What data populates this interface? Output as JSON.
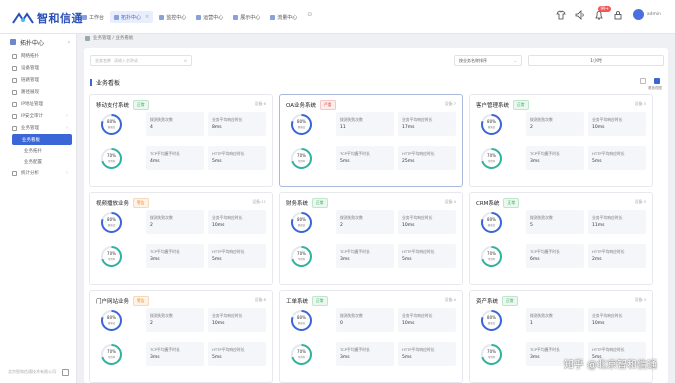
{
  "brand": {
    "name": "智和信通"
  },
  "tabs": [
    {
      "label": "工作台",
      "active": false
    },
    {
      "label": "拓扑中心",
      "active": true
    },
    {
      "label": "监控中心",
      "active": false
    },
    {
      "label": "运营中心",
      "active": false
    },
    {
      "label": "展示中心",
      "active": false
    },
    {
      "label": "流量中心",
      "active": false
    }
  ],
  "header": {
    "notification_count": "99+",
    "username": "admin"
  },
  "sidebar": {
    "title": "拓扑中心",
    "items": [
      {
        "label": "网络拓扑",
        "icon": "network-icon"
      },
      {
        "label": "设备管理",
        "icon": "device-icon"
      },
      {
        "label": "链路管理",
        "icon": "link-icon"
      },
      {
        "label": "路径展现",
        "icon": "path-icon"
      },
      {
        "label": "IP地址管理",
        "icon": "ip-icon"
      },
      {
        "label": "IP安全审计",
        "icon": "audit-icon"
      },
      {
        "label": "业务管理",
        "icon": "business-icon"
      }
    ],
    "sub": [
      {
        "label": "业务看板",
        "active": true
      },
      {
        "label": "业务拓扑",
        "active": false
      },
      {
        "label": "业务配置",
        "active": false
      }
    ],
    "after": [
      {
        "label": "统计分析",
        "icon": "stats-icon"
      }
    ],
    "footer": "北京智和信通技术有限公司"
  },
  "breadcrumb": "业务管理 / 业务看板",
  "filter": {
    "label": "业务名称",
    "placeholder": "请输入名称或"
  },
  "sort": {
    "value": "按业务名称排序"
  },
  "period": {
    "value": "1小时"
  },
  "section_title": "业务看板",
  "view_label": "看板视图",
  "metric_labels": {
    "gauge_top": "健康度",
    "gauge_bottom": "可用率",
    "stat1": "拨测失败次数",
    "stat2": "业务平均响应时长",
    "stat3": "TCP平均握手时长",
    "stat4": "HTTP平均响应时长"
  },
  "cards": [
    {
      "name": "移动支付系统",
      "status": "正常",
      "status_type": "ok",
      "devices": "设备:6",
      "health": "80%",
      "avail": "70%",
      "health_pct": 80,
      "avail_pct": 70,
      "fail_count": "4",
      "resp": "8ms",
      "tcp": "4ms",
      "http": "5ms",
      "highlight": false
    },
    {
      "name": "OA业务系统",
      "status": "严重",
      "status_type": "bad",
      "devices": "设备:7",
      "health": "80%",
      "avail": "70%",
      "health_pct": 80,
      "avail_pct": 70,
      "fail_count": "11",
      "resp": "17ms",
      "tcp": "5ms",
      "http": "25ms",
      "highlight": true
    },
    {
      "name": "客户管理系统",
      "status": "正常",
      "status_type": "ok",
      "devices": "设备:3",
      "health": "80%",
      "avail": "70%",
      "health_pct": 80,
      "avail_pct": 70,
      "fail_count": "2",
      "resp": "10ms",
      "tcp": "3ms",
      "http": "5ms",
      "highlight": false
    },
    {
      "name": "视频播放业务",
      "status": "警告",
      "status_type": "warn",
      "devices": "设备:11",
      "health": "80%",
      "avail": "70%",
      "health_pct": 80,
      "avail_pct": 70,
      "fail_count": "2",
      "resp": "10ms",
      "tcp": "3ms",
      "http": "5ms",
      "highlight": false
    },
    {
      "name": "财务系统",
      "status": "正常",
      "status_type": "ok",
      "devices": "设备:4",
      "health": "80%",
      "avail": "70%",
      "health_pct": 80,
      "avail_pct": 70,
      "fail_count": "2",
      "resp": "10ms",
      "tcp": "3ms",
      "http": "5ms",
      "highlight": false
    },
    {
      "name": "CRM系统",
      "status": "正常",
      "status_type": "ok",
      "devices": "设备:3",
      "health": "80%",
      "avail": "70%",
      "health_pct": 80,
      "avail_pct": 70,
      "fail_count": "5",
      "resp": "11ms",
      "tcp": "6ms",
      "http": "2ms",
      "highlight": false
    },
    {
      "name": "门户网站业务",
      "status": "警告",
      "status_type": "warn",
      "devices": "设备:8",
      "health": "80%",
      "avail": "70%",
      "health_pct": 80,
      "avail_pct": 70,
      "fail_count": "2",
      "resp": "10ms",
      "tcp": "3ms",
      "http": "5ms",
      "highlight": false
    },
    {
      "name": "工单系统",
      "status": "正常",
      "status_type": "ok",
      "devices": "设备:4",
      "health": "80%",
      "avail": "70%",
      "health_pct": 80,
      "avail_pct": 70,
      "fail_count": "0",
      "resp": "10ms",
      "tcp": "3ms",
      "http": "5ms",
      "highlight": false
    },
    {
      "name": "资产系统",
      "status": "正常",
      "status_type": "ok",
      "devices": "设备:3",
      "health": "80%",
      "avail": "70%",
      "health_pct": 80,
      "avail_pct": 70,
      "fail_count": "1",
      "resp": "10ms",
      "tcp": "3ms",
      "http": "5ms",
      "highlight": false
    }
  ],
  "watermark": "知乎 @北京智和信通",
  "colors": {
    "accent": "#3a66d8",
    "ok": "#2fa35a",
    "bad": "#e64a4a",
    "warn": "#e88a2e"
  }
}
